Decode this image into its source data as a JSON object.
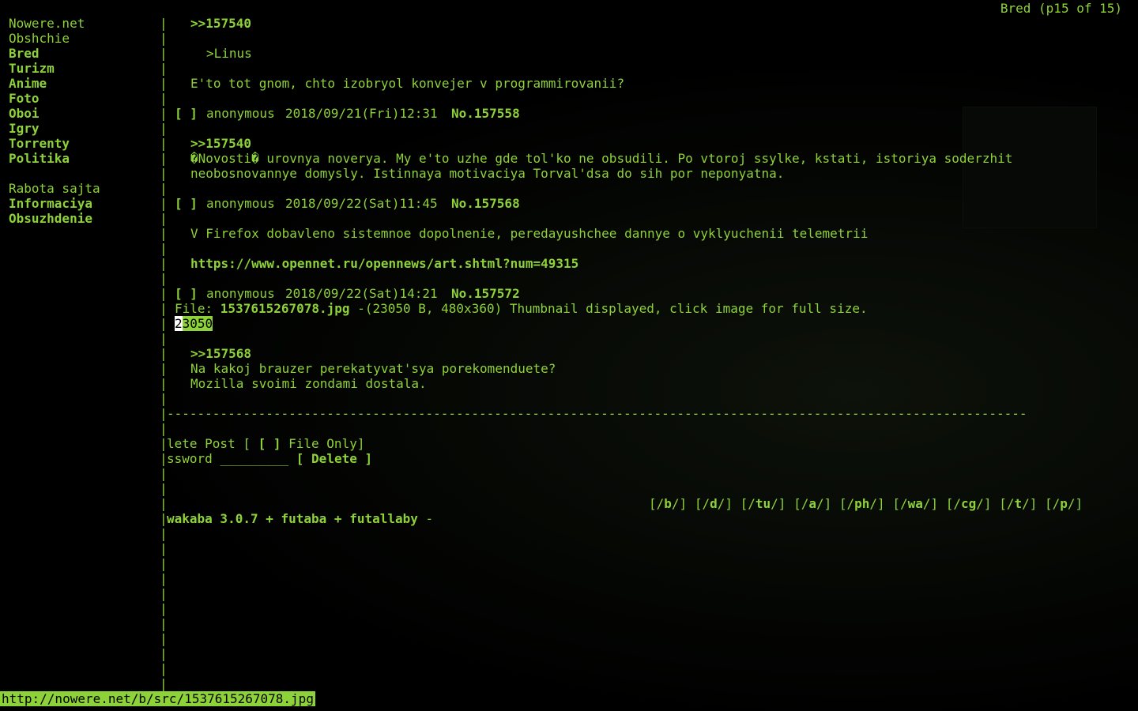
{
  "window": {
    "title": "Bred (p15 of 15)"
  },
  "sidebar": {
    "items": [
      {
        "label": "Nowere.net",
        "bold": false
      },
      {
        "label": "Obshchie",
        "bold": false
      },
      {
        "label": "Bred",
        "bold": true
      },
      {
        "label": "Turizm",
        "bold": true
      },
      {
        "label": "Anime",
        "bold": true
      },
      {
        "label": "Foto",
        "bold": true
      },
      {
        "label": "Oboi",
        "bold": true
      },
      {
        "label": "Igry",
        "bold": true
      },
      {
        "label": "Torrenty",
        "bold": true
      },
      {
        "label": "Politika",
        "bold": true
      },
      {
        "label": "",
        "bold": false
      },
      {
        "label": "Rabota sajta",
        "bold": false
      },
      {
        "label": "Informaciya",
        "bold": true
      },
      {
        "label": "Obsuzhdenie",
        "bold": true
      }
    ]
  },
  "thread": {
    "post1": {
      "reply_link": ">>157540",
      "quote": ">Linus",
      "body": "E'to tot gnom, chto izobryol konvejer v programmirovanii?"
    },
    "post2": {
      "checkbox": "[ ]",
      "author": "anonymous",
      "date": "2018/09/21(Fri)12:31",
      "number": "No.157558",
      "reply_link": ">>157540",
      "body_line1": "�Novosti� urovnya noverya. My e'to uzhe gde tol'ko ne obsudili. Po vtoroj ssylke, kstati, istoriya soderzhit",
      "body_line2": "neobosnovannye domysly. Istinnaya motivaciya Torval'dsa do sih por neponyatna."
    },
    "post3": {
      "checkbox": "[ ]",
      "author": "anonymous",
      "date": "2018/09/22(Sat)11:45",
      "number": "No.157568",
      "body": "V Firefox dobavleno sistemnoe dopolnenie, peredayushchee dannye o vyklyuchenii telemetrii",
      "link": "https://www.opennet.ru/opennews/art.shtml?num=49315"
    },
    "post4": {
      "checkbox": "[ ]",
      "author": "anonymous",
      "date": "2018/09/22(Sat)14:21",
      "number": "No.157572",
      "file_prefix": "File: ",
      "file_name": "1537615267078.jpg",
      "file_info": " -(23050 B, 480x360) Thumbnail displayed, click image for full size.",
      "thumb_cursor": "2",
      "thumb_rest": "3050",
      "reply_link": ">>157568",
      "body_line1": "Na kakoj brauzer perekatyvat'sya porekomenduete?",
      "body_line2": "Mozilla svoimi zondami dostala."
    }
  },
  "divider": "-----------------------------------------------------------------------------------------------------------------",
  "delete_form": {
    "line1_prefix": "lete Post [ ",
    "line1_checkbox": "[ ]",
    "line1_suffix": " File Only]",
    "password_label": "ssword ",
    "password_field": "_________",
    "delete_button": "[ Delete ]"
  },
  "board_links": [
    "[/b/]",
    "[/d/]",
    "[/tu/]",
    "[/a/]",
    "[/ph/]",
    "[/wa/]",
    "[/cg/]",
    "[/t/]",
    "[/p/]"
  ],
  "footer": {
    "credits": "wakaba 3.0.7 + futaba + futallaby",
    "dash": " -"
  },
  "status_url": "http://nowere.net/b/src/1537615267078.jpg"
}
